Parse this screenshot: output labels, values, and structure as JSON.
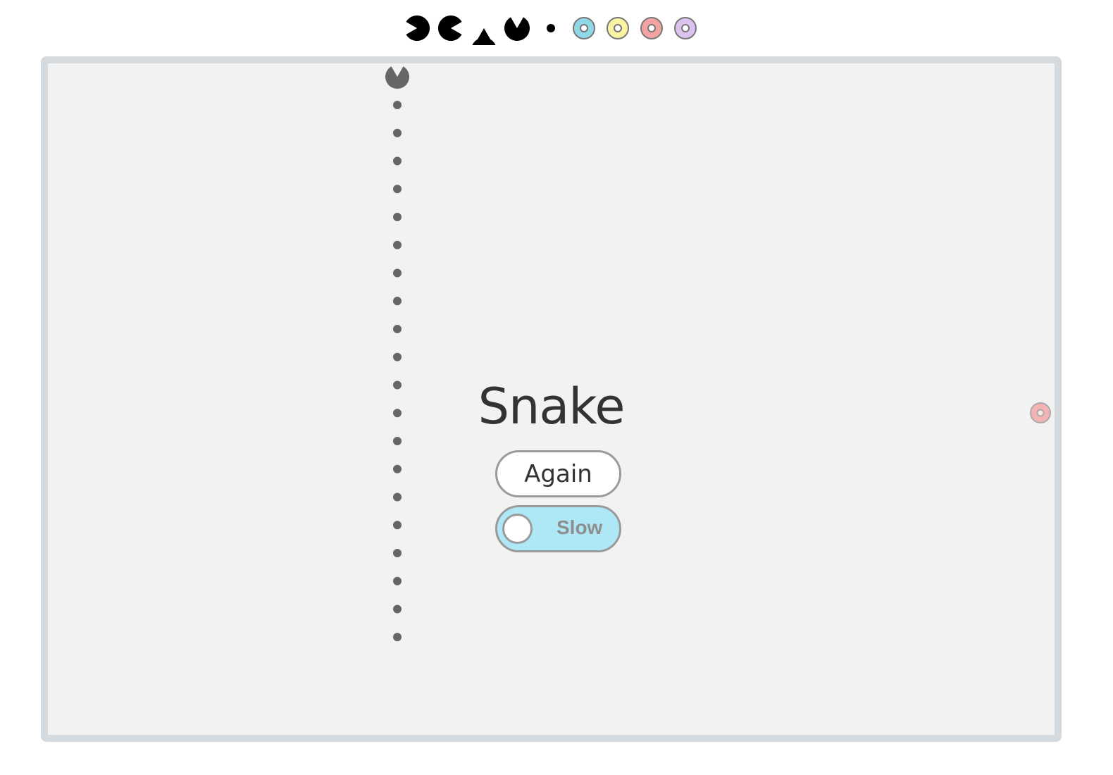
{
  "legend": {
    "pacman_directions": [
      "left",
      "right",
      "down",
      "up"
    ],
    "dot": "pellet",
    "donut_colors": [
      "#8fd8e6",
      "#fbf3a4",
      "#f4a3a3",
      "#dcc3ef"
    ]
  },
  "game": {
    "title": "Snake",
    "again_label": "Again",
    "speed_toggle": {
      "label": "Slow",
      "on": false,
      "track_color": "#aee8f6"
    },
    "snake": {
      "head_icon": "pacman-down-icon",
      "body_segments": 20,
      "color": "#666666"
    },
    "food": {
      "icon": "donut-icon",
      "color": "#f4b4b4"
    },
    "board": {
      "background": "#f2f2f2",
      "border_color": "#d4dadd"
    }
  }
}
